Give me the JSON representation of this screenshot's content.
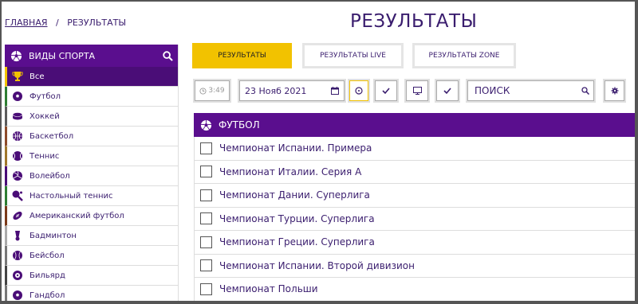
{
  "breadcrumb": {
    "home": "ГЛАВНАЯ",
    "sep": "/",
    "current": "РЕЗУЛЬТАТЫ"
  },
  "page_title": "РЕЗУЛЬТАТЫ",
  "sidebar": {
    "title": "ВИДЫ СПОРТА",
    "items": [
      {
        "label": "Все",
        "icon": "trophy-icon"
      },
      {
        "label": "Футбол",
        "icon": "soccer-ball-icon"
      },
      {
        "label": "Хоккей",
        "icon": "hockey-puck-icon"
      },
      {
        "label": "Баскетбол",
        "icon": "basketball-icon"
      },
      {
        "label": "Теннис",
        "icon": "tennis-ball-icon"
      },
      {
        "label": "Волейбол",
        "icon": "volleyball-icon"
      },
      {
        "label": "Настольный теннис",
        "icon": "ping-pong-icon"
      },
      {
        "label": "Американский футбол",
        "icon": "american-football-icon"
      },
      {
        "label": "Бадминтон",
        "icon": "shuttlecock-icon"
      },
      {
        "label": "Бейсбол",
        "icon": "baseball-icon"
      },
      {
        "label": "Бильярд",
        "icon": "billiard-ball-icon"
      },
      {
        "label": "Гандбол",
        "icon": "handball-icon"
      }
    ]
  },
  "tabs": [
    {
      "label": "РЕЗУЛЬТАТЫ"
    },
    {
      "label": "РЕЗУЛЬТАТЫ LIVE"
    },
    {
      "label": "РЕЗУЛЬТАТЫ ZONE"
    }
  ],
  "controls": {
    "time": "3:49",
    "date": "23 Нояб 2021",
    "search_placeholder": "ПОИСК"
  },
  "section": {
    "title": "ФУТБОЛ",
    "leagues": [
      "Чемпионат Испании. Примера",
      "Чемпионат Италии. Серия А",
      "Чемпионат Дании. Суперлига",
      "Чемпионат Турции. Суперлига",
      "Чемпионат Греции. Суперлига",
      "Чемпионат Испании. Второй дивизион",
      "Чемпионат Польши"
    ]
  },
  "colors": {
    "brand_purple": "#5a0e8e",
    "accent_yellow": "#f2c200",
    "text_purple": "#3a1d6e"
  }
}
